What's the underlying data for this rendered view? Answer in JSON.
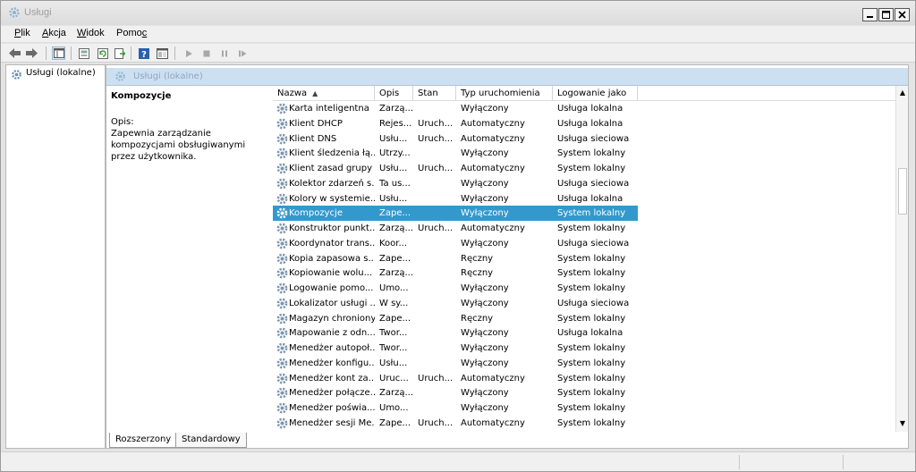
{
  "window": {
    "title": "Usługi",
    "icon": "gear-icon"
  },
  "menu": [
    {
      "key": "plik",
      "underline": "P",
      "rest": "lik"
    },
    {
      "key": "akcja",
      "underline": "A",
      "rest": "kcja"
    },
    {
      "key": "widok",
      "underline": "W",
      "rest": "idok"
    },
    {
      "key": "pomoc",
      "pre": "Pomo",
      "underline": "c"
    }
  ],
  "toolbar": [
    "back-arrow-icon",
    "forward-arrow-icon",
    "show-hide-tree-icon",
    "properties-icon",
    "refresh-icon",
    "export-list-icon",
    "help-icon",
    "console-view-icon",
    "play-icon",
    "stop-icon",
    "pause-icon",
    "restart-icon"
  ],
  "tree": {
    "label": "Usługi (lokalne)"
  },
  "panel": {
    "header": "Usługi (lokalne)"
  },
  "description": {
    "title": "Kompozycje",
    "opis_label": "Opis:",
    "text": "Zapewnia zarządzanie kompozycjami obsługiwanymi przez użytkownika."
  },
  "columns": [
    "Nazwa",
    "Opis",
    "Stan",
    "Typ uruchomienia",
    "Logowanie jako"
  ],
  "rows": [
    {
      "name": "Karta inteligentna",
      "desc": "Zarzą...",
      "state": "",
      "startup": "Wyłączony",
      "logon": "Usługa lokalna"
    },
    {
      "name": "Klient DHCP",
      "desc": "Rejes...",
      "state": "Uruch...",
      "startup": "Automatyczny",
      "logon": "Usługa lokalna"
    },
    {
      "name": "Klient DNS",
      "desc": "Usłu...",
      "state": "Uruch...",
      "startup": "Automatyczny",
      "logon": "Usługa sieciowa"
    },
    {
      "name": "Klient śledzenia łą...",
      "desc": "Utrzy...",
      "state": "",
      "startup": "Wyłączony",
      "logon": "System lokalny"
    },
    {
      "name": "Klient zasad grupy",
      "desc": "Usłu...",
      "state": "Uruch...",
      "startup": "Automatyczny",
      "logon": "System lokalny"
    },
    {
      "name": "Kolektor zdarzeń s...",
      "desc": "Ta us...",
      "state": "",
      "startup": "Wyłączony",
      "logon": "Usługa sieciowa"
    },
    {
      "name": "Kolory w systemie...",
      "desc": "Usłu...",
      "state": "",
      "startup": "Wyłączony",
      "logon": "Usługa lokalna"
    },
    {
      "name": "Kompozycje",
      "desc": "Zape...",
      "state": "",
      "startup": "Wyłączony",
      "logon": "System lokalny",
      "selected": true
    },
    {
      "name": "Konstruktor punkt...",
      "desc": "Zarzą...",
      "state": "Uruch...",
      "startup": "Automatyczny",
      "logon": "System lokalny"
    },
    {
      "name": "Koordynator trans...",
      "desc": "Koor...",
      "state": "",
      "startup": "Wyłączony",
      "logon": "Usługa sieciowa"
    },
    {
      "name": "Kopia zapasowa s...",
      "desc": "Zape...",
      "state": "",
      "startup": "Ręczny",
      "logon": "System lokalny"
    },
    {
      "name": "Kopiowanie wolu...",
      "desc": "Zarzą...",
      "state": "",
      "startup": "Ręczny",
      "logon": "System lokalny"
    },
    {
      "name": "Logowanie pomo...",
      "desc": "Umo...",
      "state": "",
      "startup": "Wyłączony",
      "logon": "System lokalny"
    },
    {
      "name": "Lokalizator usługi ...",
      "desc": "W sy...",
      "state": "",
      "startup": "Wyłączony",
      "logon": "Usługa sieciowa"
    },
    {
      "name": "Magazyn chroniony",
      "desc": "Zape...",
      "state": "",
      "startup": "Ręczny",
      "logon": "System lokalny"
    },
    {
      "name": "Mapowanie z odn...",
      "desc": "Twor...",
      "state": "",
      "startup": "Wyłączony",
      "logon": "Usługa lokalna"
    },
    {
      "name": "Menedżer autopoł...",
      "desc": "Twor...",
      "state": "",
      "startup": "Wyłączony",
      "logon": "System lokalny"
    },
    {
      "name": "Menedżer konfigu...",
      "desc": "Usłu...",
      "state": "",
      "startup": "Wyłączony",
      "logon": "System lokalny"
    },
    {
      "name": "Menedżer kont za...",
      "desc": "Uruc...",
      "state": "Uruch...",
      "startup": "Automatyczny",
      "logon": "System lokalny"
    },
    {
      "name": "Menedżer połącze...",
      "desc": "Zarzą...",
      "state": "",
      "startup": "Wyłączony",
      "logon": "System lokalny"
    },
    {
      "name": "Menedżer poświa...",
      "desc": "Umo...",
      "state": "",
      "startup": "Wyłączony",
      "logon": "System lokalny"
    },
    {
      "name": "Menedżer sesji Me...",
      "desc": "Zape...",
      "state": "Uruch...",
      "startup": "Automatyczny",
      "logon": "System lokalny"
    }
  ],
  "tabs": [
    "Rozszerzony",
    "Standardowy"
  ],
  "colors": {
    "selection": "#3399cc",
    "panel_header": "#cde0f2"
  }
}
